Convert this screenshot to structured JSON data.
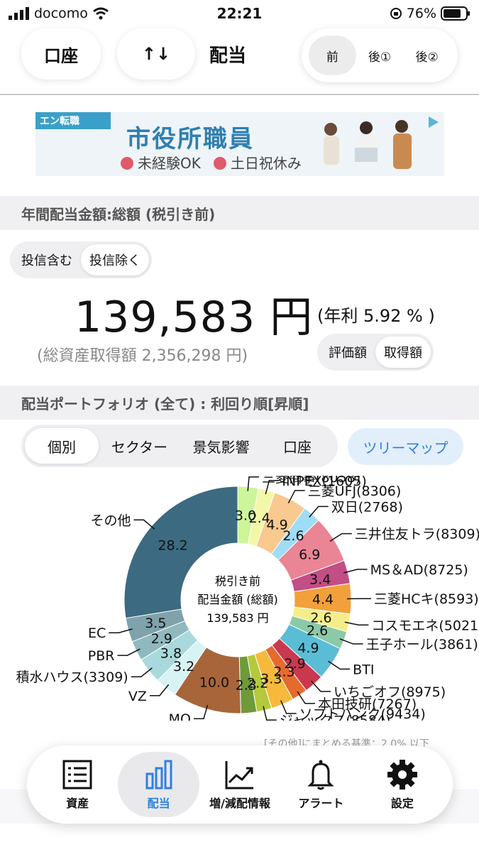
{
  "status_bar": {
    "carrier": "docomo",
    "time": "22:21",
    "battery": "76%"
  },
  "top_nav": {
    "account_label": "口座",
    "sort_label": "↑↓",
    "title": "配当",
    "tax_options": [
      "前",
      "後①",
      "後②"
    ],
    "tax_selected": "前"
  },
  "ad": {
    "logo": "エン転職",
    "headline": "市役所職員",
    "point1": "未経験OK",
    "point2": "土日祝休み"
  },
  "annual": {
    "header": "年間配当金額:総額 (税引き前)",
    "toggle": [
      "投信含む",
      "投信除く"
    ],
    "toggle_selected": "投信除く",
    "amount": "139,583 円",
    "rate": "(年利 5.92 % )",
    "acquisition": "(総資産取得額 2,356,298 円)",
    "basis_toggle": [
      "評価額",
      "取得額"
    ],
    "basis_selected": "取得額"
  },
  "portfolio": {
    "header": "配当ポートフォリオ (全て) : 利回り順[昇順]",
    "tabs": [
      "個別",
      "セクター",
      "景気影響",
      "口座"
    ],
    "tab_selected": "個別",
    "treemap_label": "ツリーマップ",
    "center_line1": "税引き前",
    "center_line2": "配当金額 (総額)",
    "center_line3": "139,583 円",
    "note": "[その他]にまとめる基準：2.0% 以下"
  },
  "chart_data": {
    "type": "pie",
    "title": "",
    "segments": [
      {
        "label": "三菱商事(8058)",
        "value": 3.0,
        "color": "#cdf59a"
      },
      {
        "label": "INPEX(1605)",
        "value": 2.4,
        "color": "#f3f7a8"
      },
      {
        "label": "三菱UFJ(8306)",
        "value": 4.9,
        "color": "#f9c98f"
      },
      {
        "label": "双日(2768)",
        "value": 2.6,
        "color": "#9fdcf5"
      },
      {
        "label": "三井住友トラ(8309)",
        "value": 6.9,
        "color": "#e98595"
      },
      {
        "label": "MS＆AD(8725)",
        "value": 3.4,
        "color": "#c24e86"
      },
      {
        "label": "三菱HCキ(8593)",
        "value": 4.4,
        "color": "#f2a03a"
      },
      {
        "label": "コスモエネ(5021)",
        "value": 2.6,
        "color": "#f4ee8a"
      },
      {
        "label": "王子ホール(3861)",
        "value": 2.6,
        "color": "#8cc9a7"
      },
      {
        "label": "BTI",
        "value": 4.9,
        "color": "#5bbcd6"
      },
      {
        "label": "いちごオフ(8975)",
        "value": 2.9,
        "color": "#c9384e"
      },
      {
        "label": "本田技研(7267)",
        "value": 2.3,
        "color": "#e66a2c"
      },
      {
        "label": "ソフトバンク(9434)",
        "value": 3.3,
        "color": "#f6b93b"
      },
      {
        "label": "ジャックス(8584)",
        "value": 2.2,
        "color": "#b5c93d"
      },
      {
        "label": "",
        "value": 2.3,
        "color": "#6f9a3a"
      },
      {
        "label": "MO",
        "value": 10.0,
        "color": "#a8653a"
      },
      {
        "label": "VZ",
        "value": 3.2,
        "color": "#d7f3f4"
      },
      {
        "label": "積水ハウス(3309)",
        "value": 3.8,
        "color": "#a9d9dc"
      },
      {
        "label": "PBR",
        "value": 2.9,
        "color": "#8fb9be"
      },
      {
        "label": "EC",
        "value": 3.5,
        "color": "#7fa2ab"
      },
      {
        "label": "その他",
        "value": 28.2,
        "color": "#3c6a80"
      }
    ]
  },
  "tabbar": {
    "items": [
      "資産",
      "配当",
      "増/減配情報",
      "アラート",
      "設定"
    ],
    "selected": "配当"
  }
}
